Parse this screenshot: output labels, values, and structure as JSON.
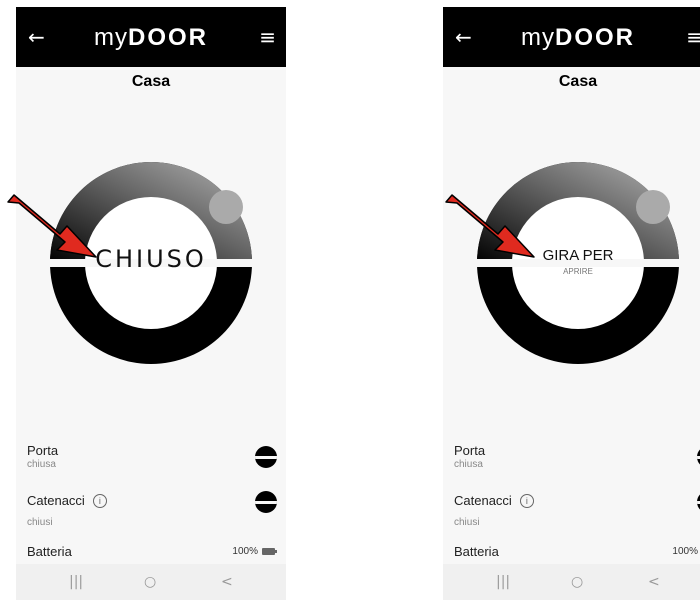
{
  "left": {
    "app_name_prefix": "my",
    "app_name_brand": "DOOR",
    "back_icon": "←",
    "menu_icon": "≡",
    "title": "Casa",
    "dial_text": "CHIUSO",
    "status": {
      "porta_label": "Porta",
      "porta_value": "chiusa",
      "catenacci_label": "Catenacci",
      "catenacci_value": "chiusi",
      "info_icon": "i",
      "batteria_label": "Batteria",
      "batteria_value": "100%"
    },
    "nav": {
      "recents": "|||",
      "home": "○",
      "back": "<"
    }
  },
  "right": {
    "app_name_prefix": "my",
    "app_name_brand": "DOOR",
    "back_icon": "←",
    "menu_icon": "≡",
    "title": "Casa",
    "dial_text": "GIRA PER",
    "dial_subtext": "APRIRE",
    "status": {
      "porta_label": "Porta",
      "porta_value": "chiusa",
      "catenacci_label": "Catenacci",
      "catenacci_value": "chiusi",
      "info_icon": "i",
      "batteria_label": "Batteria",
      "batteria_value": "100%"
    },
    "nav": {
      "recents": "|||",
      "home": "○",
      "back": "<"
    }
  },
  "colors": {
    "app_bar": "#000000",
    "ring": "#000000",
    "arrow": "#e02a1f",
    "screen_bg": "#f7f7f7"
  }
}
